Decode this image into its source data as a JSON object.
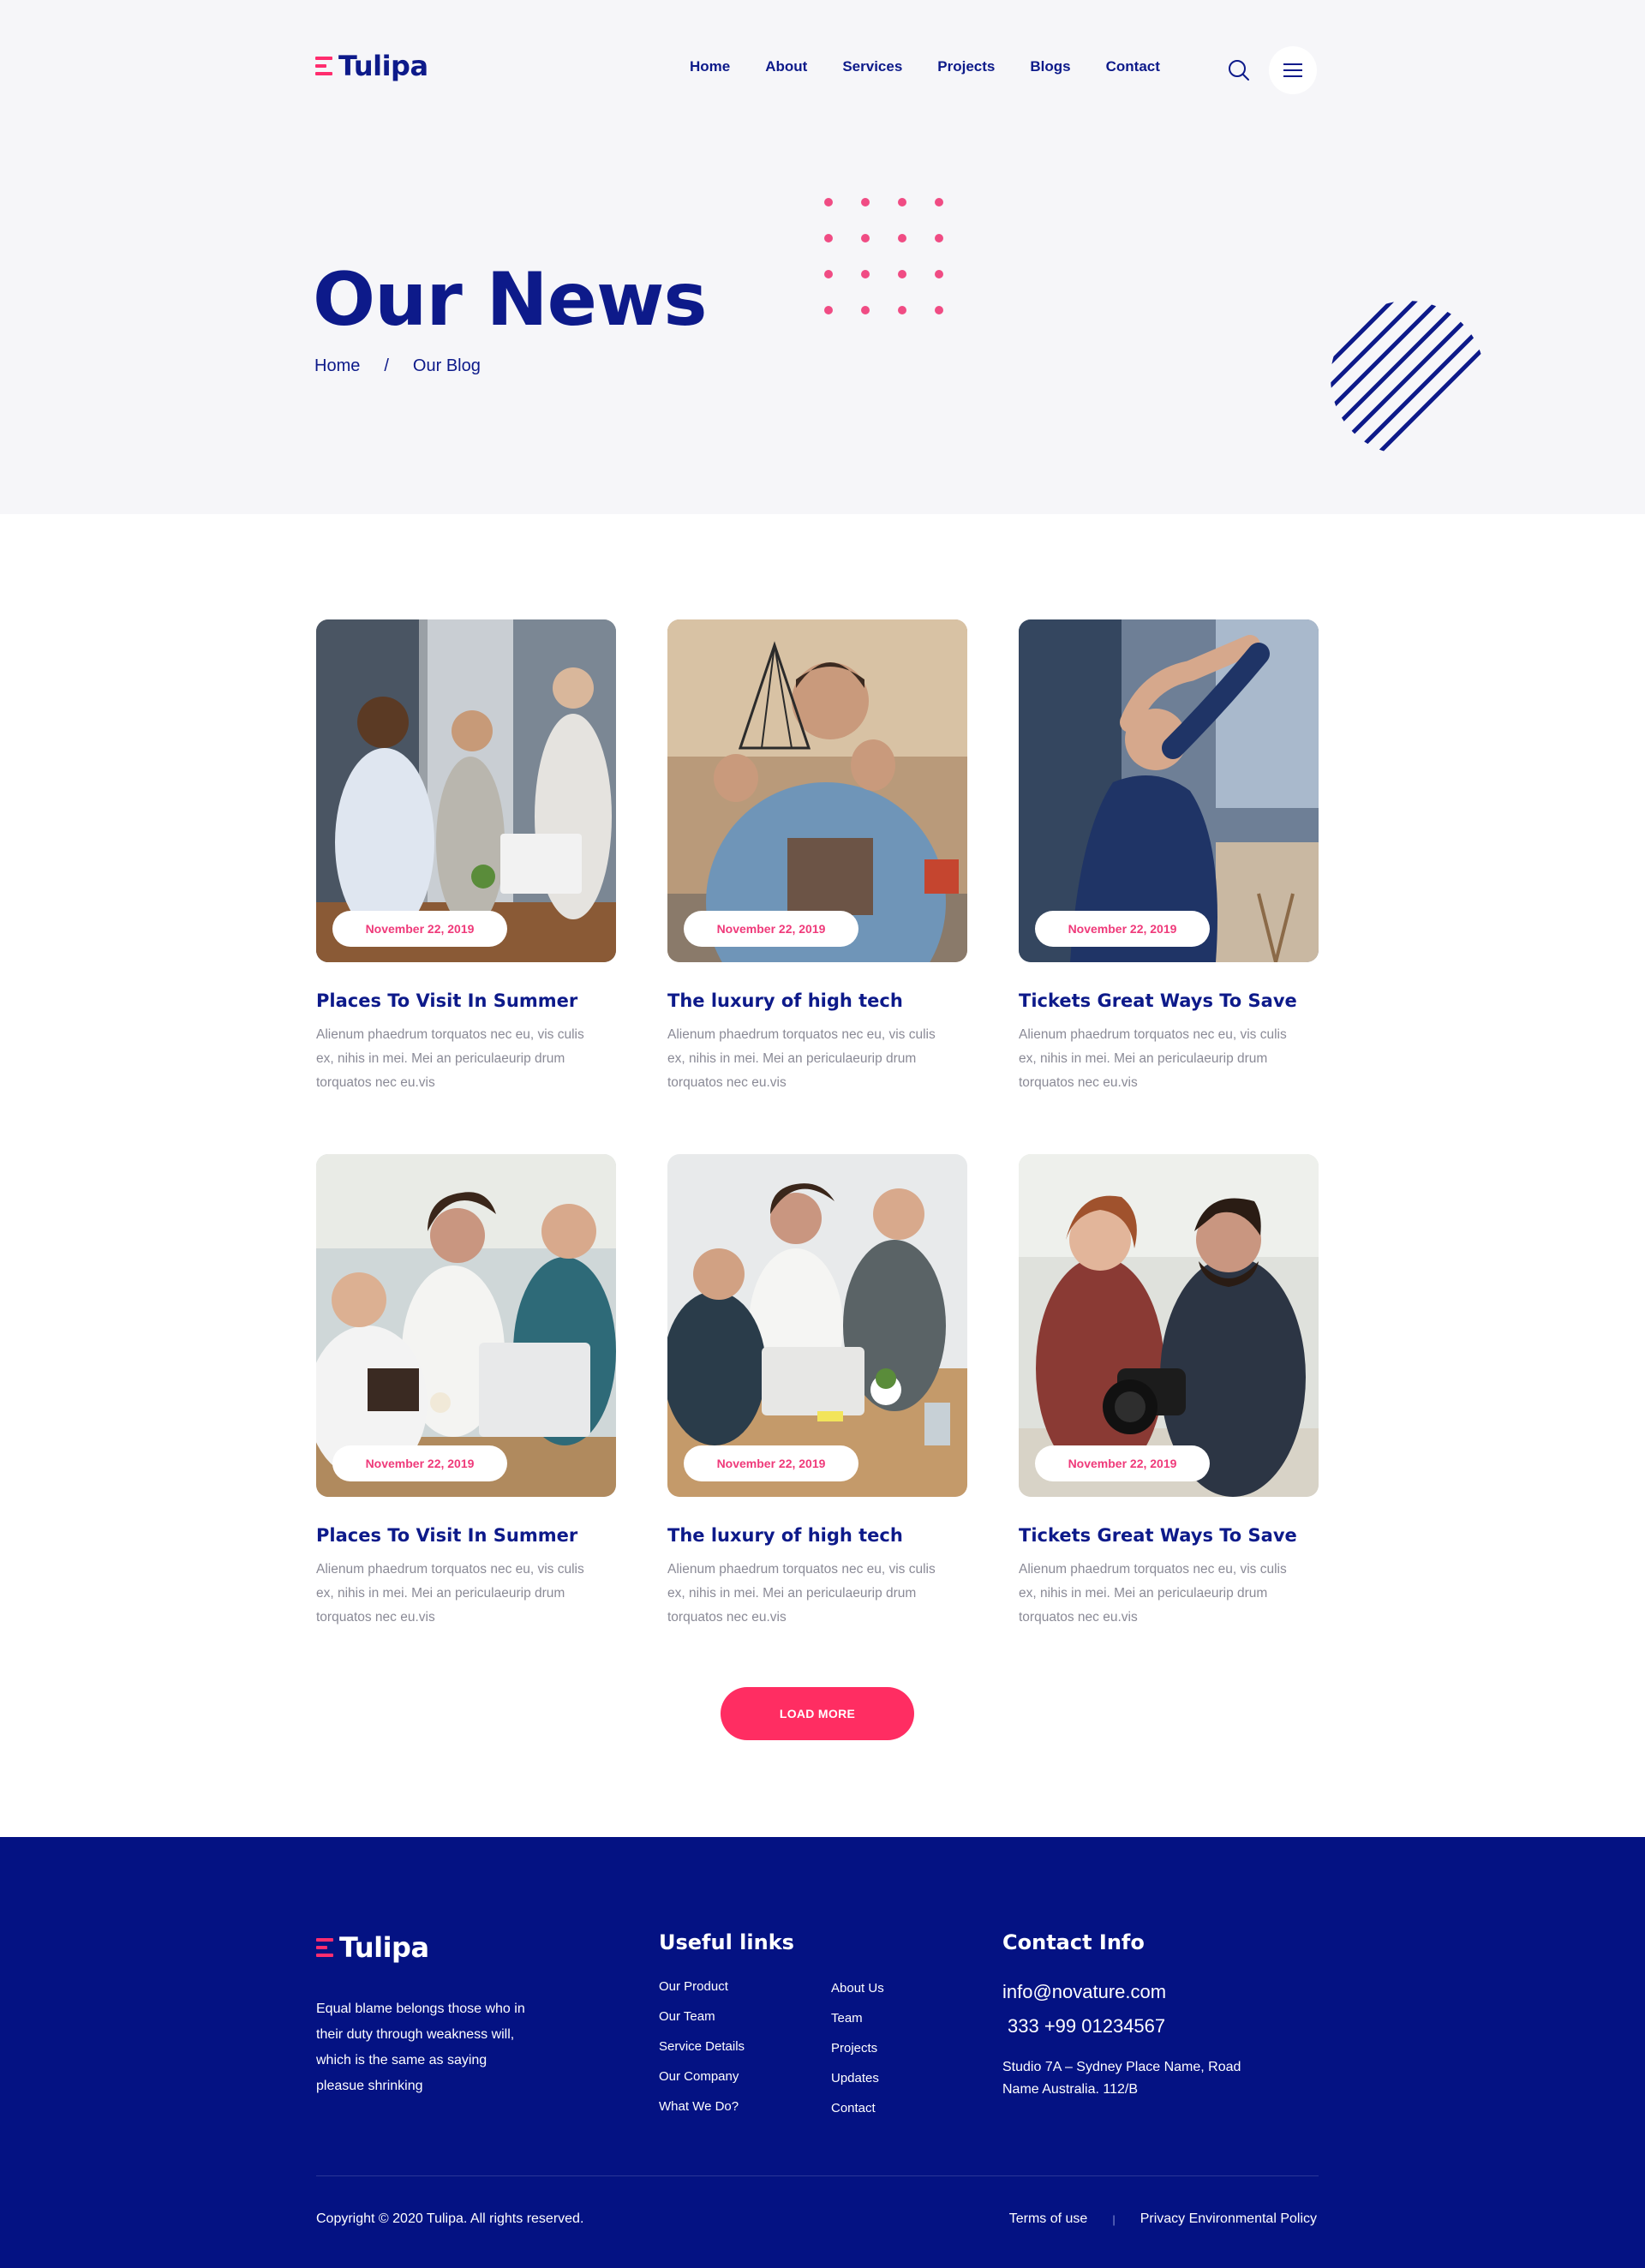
{
  "brand": {
    "name": "Tulipa",
    "accent": "#ff2d6e",
    "navy": "#0d1a8a",
    "footer_bg": "#041283"
  },
  "nav": {
    "items": [
      "Home",
      "About",
      "Services",
      "Projects",
      "Blogs",
      "Contact"
    ],
    "search_icon": "search-icon",
    "menu_icon": "hamburger-menu-icon"
  },
  "hero": {
    "title": "Our News",
    "breadcrumb": {
      "home": "Home",
      "separator": "/",
      "current": "Our Blog"
    }
  },
  "posts": [
    {
      "date": "November 22, 2019",
      "title": "Places To Visit In Summer",
      "excerpt": "Alienum phaedrum torquatos nec eu, vis culis ex, nihis in mei. Mei an periculaeurip drum torquatos nec eu.vis",
      "image": "team-meeting-photo"
    },
    {
      "date": "November 22, 2019",
      "title": "The luxury of high tech",
      "excerpt": "Alienum phaedrum torquatos nec eu, vis culis ex, nihis in mei. Mei an periculaeurip drum torquatos nec eu.vis",
      "image": "man-holding-prism-photo"
    },
    {
      "date": "November 22, 2019",
      "title": "Tickets Great Ways To Save",
      "excerpt": "Alienum phaedrum torquatos nec eu, vis culis ex, nihis in mei. Mei an periculaeurip drum torquatos nec eu.vis",
      "image": "man-stretching-photo"
    },
    {
      "date": "November 22, 2019",
      "title": "Places To Visit In Summer",
      "excerpt": "Alienum phaedrum torquatos nec eu, vis culis ex, nihis in mei. Mei an periculaeurip drum torquatos nec eu.vis",
      "image": "team-at-laptop-photo"
    },
    {
      "date": "November 22, 2019",
      "title": "The luxury of high tech",
      "excerpt": "Alienum phaedrum torquatos nec eu, vis culis ex, nihis in mei. Mei an periculaeurip drum torquatos nec eu.vis",
      "image": "group-around-laptop-photo"
    },
    {
      "date": "November 22, 2019",
      "title": "Tickets Great Ways To Save",
      "excerpt": "Alienum phaedrum torquatos nec eu, vis culis ex, nihis in mei. Mei an periculaeurip drum torquatos nec eu.vis",
      "image": "couple-with-camera-photo"
    }
  ],
  "load_more": "LOAD MORE",
  "footer": {
    "about": "Equal blame belongs those who in their duty through weakness will, which is the same as saying pleasue shrinking",
    "useful_links_title": "Useful links",
    "links_left": [
      "Our Product",
      "Our Team",
      "Service Details",
      "Our Company",
      "What We Do?"
    ],
    "links_right": [
      "About Us",
      "Team",
      "Projects",
      "Updates",
      "Contact"
    ],
    "contact_title": "Contact Info",
    "email": "info@novature.com",
    "phone": "333 +99 01234567",
    "address": "Studio 7A – Sydney Place Name, Road Name Australia. 112/B",
    "copyright": "Copyright © 2020 Tulipa. All rights reserved.",
    "terms": "Terms of use",
    "legal_separator": "|",
    "privacy": "Privacy Environmental Policy"
  }
}
